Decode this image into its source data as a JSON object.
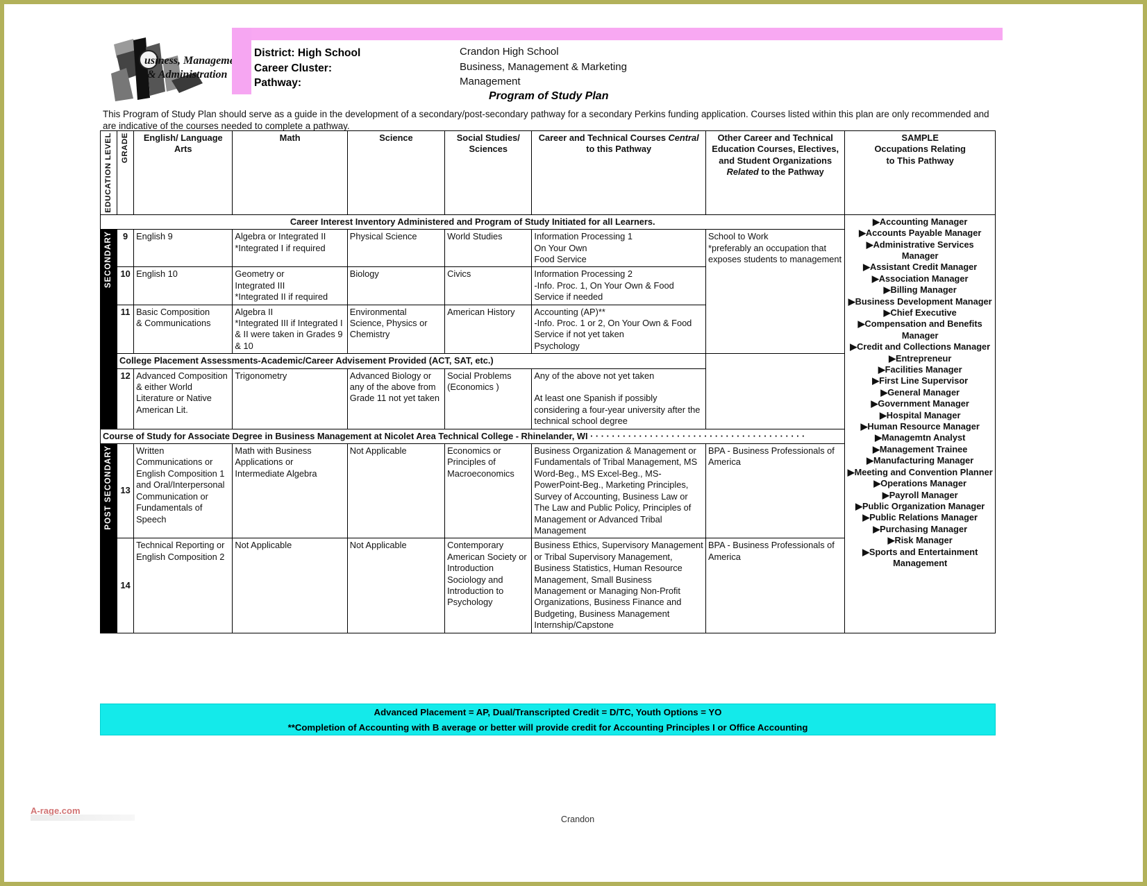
{
  "header": {
    "logo_line1": "Business, Management",
    "logo_line2": "& Administration",
    "labels": {
      "district": "District: High School",
      "cluster": "Career Cluster:",
      "pathway": "Pathway:"
    },
    "values": {
      "district": "Crandon High School",
      "cluster": "Business, Management & Marketing",
      "pathway": "Management"
    },
    "doc_title": "Program of Study Plan",
    "intro": "This Program of Study Plan should serve as a guide in the development of a secondary/post-secondary pathway for a secondary Perkins funding application.  Courses listed within this plan are only recommended and are indicative of the courses needed to complete a pathway."
  },
  "table": {
    "columns": {
      "education_level": "EDUCATION LEVEL",
      "grade": "GRADE",
      "english": "English/ Language Arts",
      "math": "Math",
      "science": "Science",
      "social": "Social Studies/ Sciences",
      "cte_central": "Career and Technical Courses Central to this Pathway",
      "cte_central_pre": "Career and Technical Courses ",
      "cte_central_em": "Central",
      "cte_central_post": " to this Pathway",
      "other_line1": "Other Career and Technical",
      "other_line2": "Education Courses, Electives,",
      "other_line3": "and Student Organizations",
      "other_em": "Related",
      "other_line4_post": " to the Pathway",
      "sample_line1": "SAMPLE",
      "sample_line2": "Occupations Relating",
      "sample_line3": "to This Pathway"
    },
    "level_secondary": "SECONDARY",
    "level_post_secondary": "POST SECONDARY",
    "banner_career_interest": "Career Interest Inventory Administered and Program of Study Initiated for all Learners.",
    "banner_college_placement": "College Placement Assessments-Academic/Career Advisement Provided (ACT, SAT, etc.)",
    "banner_associate": "Course of Study for Associate Degree in Business Management at Nicolet Area Technical College - Rhinelander, WI",
    "rows": [
      {
        "grade": "9",
        "english": "English 9",
        "math": "Algebra or Integrated II\n*Integrated I if required",
        "science": "Physical Science",
        "social": "World Studies",
        "cte": "Information Processing 1\nOn Your Own\nFood Service",
        "other": "School to Work\n*preferably an occupation that exposes students to management"
      },
      {
        "grade": "10",
        "english": "English 10",
        "math": "Geometry or\nIntegrated III\n*Integrated II if required",
        "science": "Biology",
        "social": "Civics",
        "cte": "Information Processing 2\n-Info. Proc. 1, On Your Own & Food Service if needed",
        "other": ""
      },
      {
        "grade": "11",
        "english": "Basic Composition\n& Communications",
        "math": "Algebra II\n*Integrated III if Integrated I & II were taken in Grades 9 & 10",
        "science": "Environmental Science, Physics or Chemistry",
        "social": "American History",
        "cte": "Accounting (AP)**\n-Info. Proc. 1 or 2, On Your Own & Food Service if not yet taken\nPsychology",
        "other": ""
      },
      {
        "grade": "12",
        "english": "Advanced Composition & either World Literature or Native American Lit.",
        "math": "Trigonometry",
        "science": "Advanced Biology or any of the above from Grade 11 not yet taken",
        "social": "Social Problems (Economics )",
        "cte": "Any of the above not yet taken\n\nAt least one Spanish if possibly considering a four-year university after the technical school degree",
        "other": ""
      },
      {
        "grade": "13",
        "english": "Written Communications or English Composition 1 and Oral/Interpersonal Communication or Fundamentals of Speech",
        "math": "Math with Business Applications or Intermediate Algebra",
        "science": "Not Applicable",
        "social": "Economics or Principles of Macroeconomics",
        "cte": "Business Organization & Management or Fundamentals of Tribal Management, MS Word-Beg., MS Excel-Beg., MS-PowerPoint-Beg., Marketing Principles, Survey of Accounting, Business Law or The Law and Public Policy, Principles of Management or Advanced Tribal Management",
        "other": "BPA - Business Professionals of America"
      },
      {
        "grade": "14",
        "english": "Technical Reporting or English Composition 2",
        "math": "Not Applicable",
        "science": "Not Applicable",
        "social": "Contemporary American Society or Introduction Sociology and Introduction to Psychology",
        "cte": "Business Ethics, Supervisory Management or Tribal Supervisory Management, Business Statistics, Human Resource Management, Small Business Management or Managing Non-Profit Organizations, Business Finance and Budgeting, Business Management Internship/Capstone",
        "other": "BPA - Business Professionals of America"
      }
    ],
    "occupations": [
      "Accounting Manager",
      "Accounts Payable Manager",
      "Administrative Services Manager",
      "Assistant Credit Manager",
      "Association Manager",
      "Billing Manager",
      "Business Development Manager",
      "Chief Executive",
      "Compensation and Benefits Manager",
      "Credit and Collections Manager",
      "Entrepreneur",
      "Facilities Manager",
      "First Line Supervisor",
      "General Manager",
      "Government Manager",
      "Hospital Manager",
      "Human Resource Manager",
      "Managemtn Analyst",
      "Management Trainee",
      "Manufacturing Manager",
      "Meeting and Convention Planner",
      "Operations Manager",
      "Payroll Manager",
      "Public Organization Manager",
      "Public Relations Manager",
      "Purchasing Manager",
      "Risk Manager",
      "Sports and Entertainment Management"
    ]
  },
  "footer": {
    "line1": "Advanced Placement = AP, Dual/Transcripted Credit = D/TC, Youth Options = YO",
    "line2": "**Completion of Accounting with B average or better will provide credit for Accounting Principles I or Office Accounting",
    "page_label": "Crandon",
    "watermark": "A-rage.com"
  },
  "colors": {
    "pink": "#f8a8f2",
    "cyan": "#14eaea",
    "header_gray": "#e6e6e6",
    "cell_shade": "#e4e4e4",
    "level_black": "#000000",
    "page_border": "#b2b15a"
  }
}
